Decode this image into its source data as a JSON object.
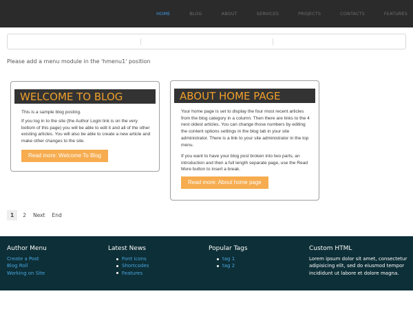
{
  "nav": {
    "items": [
      {
        "label": "HOME",
        "active": true
      },
      {
        "label": "BLOG",
        "active": false
      },
      {
        "label": "ABOUT",
        "active": false
      },
      {
        "label": "SERVICES",
        "active": false
      },
      {
        "label": "PROJECTS",
        "active": false
      },
      {
        "label": "CONTACTS",
        "active": false
      },
      {
        "label": "FEATURES",
        "active": false
      }
    ]
  },
  "notice": "Please add a menu module in the 'hmenu1' position",
  "articles": [
    {
      "title": "WELCOME TO BLOG",
      "paragraphs": [
        "This is a sample blog posting.",
        "If you log in to the site (the Author Login link is on the very bottom of this page) you will be able to edit it and all of the other existing articles. You will also be able to create a new article and make other changes to the site."
      ],
      "button": "Read more: Welcome To Blog"
    },
    {
      "title": "ABOUT HOME PAGE",
      "paragraphs": [
        "Your home page is set to display the four most recent articles from the blog category in a column. Then there are links to the 4 nest oldest articles. You can change those numbers by editing the content options settings in the blog tab in your site administrator. There is a link to your site administrator in the top menu.",
        "If you want to have your blog post broken into two parts, an introduction and then a full length separate page, use the Read More button to insert a break."
      ],
      "button": "Read more: About home page"
    }
  ],
  "pagination": {
    "current": "1",
    "page2": "2",
    "next": "Next",
    "end": "End"
  },
  "footer": {
    "author_menu": {
      "title": "Author Menu",
      "links": [
        "Create a Post",
        "Blog Roll",
        "Working on Site"
      ]
    },
    "latest_news": {
      "title": "Latest News",
      "items": [
        "Font icons",
        "Shortcodes",
        "Features"
      ]
    },
    "popular_tags": {
      "title": "Popular Tags",
      "items": [
        "tag 1",
        "tag 2"
      ]
    },
    "custom_html": {
      "title": "Custom HTML",
      "text": "Lorem ipsum dolor sit amet, consectetur adipisicing elit, sed do eiusmod tempor incididunt ut labore et dolore magna."
    }
  },
  "colors": {
    "nav_active": "#3f9ce6",
    "accent_orange": "#f6ac4f",
    "title_orange": "#f0a02c",
    "footer_bg": "#0d2f37",
    "link_blue": "#4aa6e0"
  }
}
